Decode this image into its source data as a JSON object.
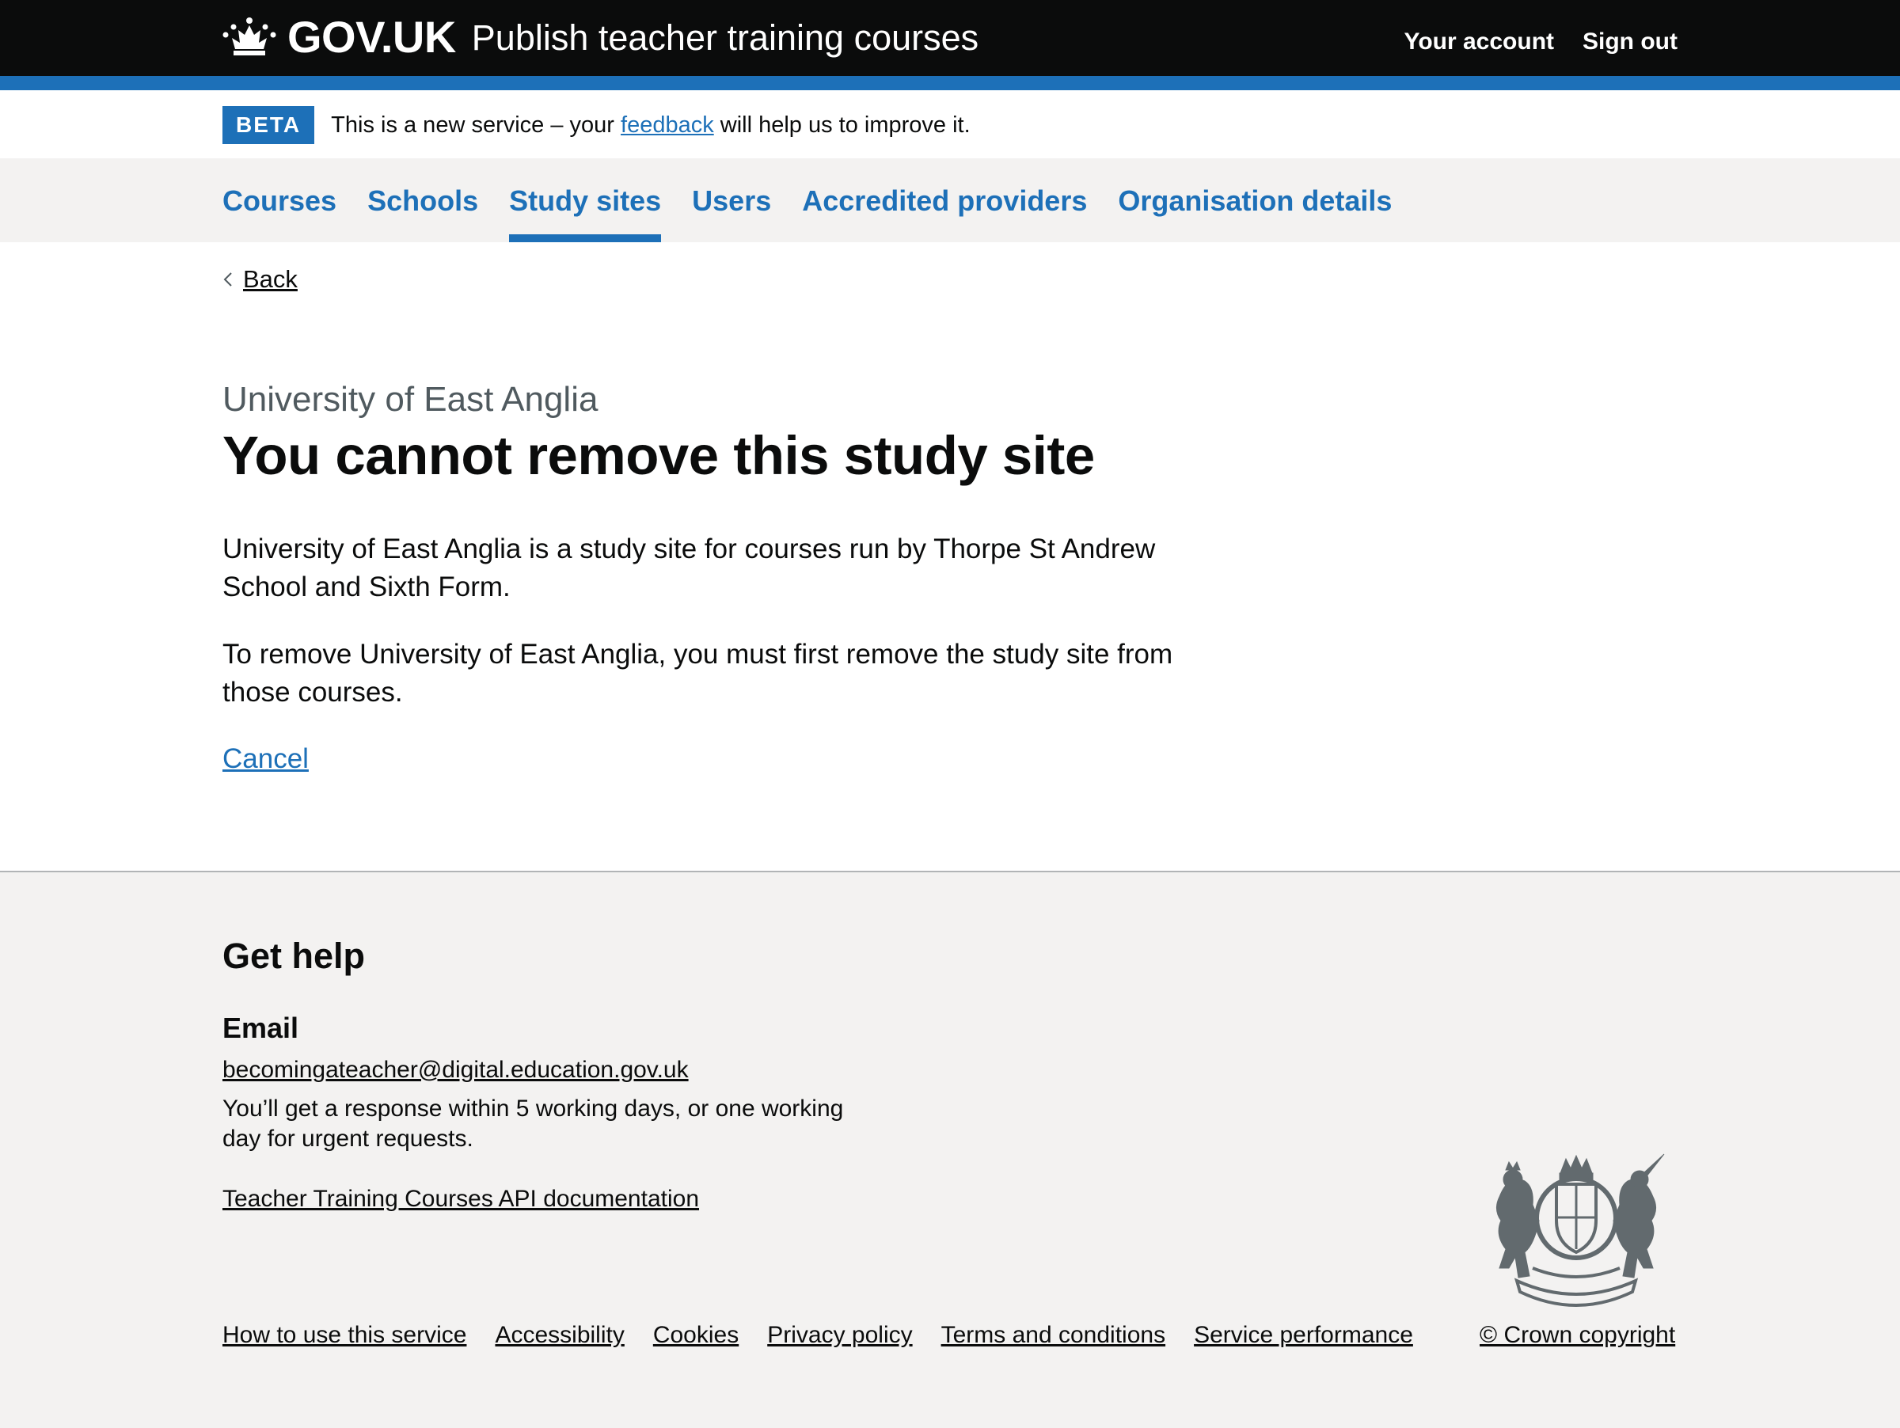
{
  "header": {
    "logo_text": "GOV.UK",
    "service_name": "Publish teacher training courses",
    "nav": [
      {
        "label": "Your account"
      },
      {
        "label": "Sign out"
      }
    ],
    "icons": {
      "logo": "crown-icon"
    }
  },
  "phase_banner": {
    "tag": "BETA",
    "text_before": "This is a new service – your ",
    "link": "feedback",
    "text_after": " will help us to improve it."
  },
  "primary_nav": {
    "items": [
      {
        "label": "Courses",
        "active": false
      },
      {
        "label": "Schools",
        "active": false
      },
      {
        "label": "Study sites",
        "active": true
      },
      {
        "label": "Users",
        "active": false
      },
      {
        "label": "Accredited providers",
        "active": false
      },
      {
        "label": "Organisation details",
        "active": false
      }
    ]
  },
  "back_link": {
    "label": "Back",
    "icon": "chevron-left-icon"
  },
  "main": {
    "caption": "University of East Anglia",
    "heading": "You cannot remove this study site",
    "paragraph_1": "University of East Anglia is a study site for courses run by Thorpe St Andrew School and Sixth Form.",
    "paragraph_2": "To remove University of East Anglia, you must first remove the study site from those courses.",
    "cancel_link": "Cancel"
  },
  "footer": {
    "title": "Get help",
    "email_heading": "Email",
    "email": "becomingateacher@digital.education.gov.uk",
    "response_note": "You’ll get a response within 5 working days, or one working day for urgent requests.",
    "api_link": "Teacher Training Courses API documentation",
    "links": [
      {
        "label": "How to use this service"
      },
      {
        "label": "Accessibility"
      },
      {
        "label": "Cookies"
      },
      {
        "label": "Privacy policy"
      },
      {
        "label": "Terms and conditions"
      },
      {
        "label": "Service performance"
      }
    ],
    "copyright": "© Crown copyright",
    "crest_icon": "royal-coat-of-arms-icon"
  },
  "colors": {
    "header_bg": "#0b0c0c",
    "brand_blue": "#1d70b8",
    "text": "#0b0c0c",
    "secondary_text": "#505a5f",
    "light_bg": "#f3f2f1",
    "border": "#b1b4b6"
  }
}
